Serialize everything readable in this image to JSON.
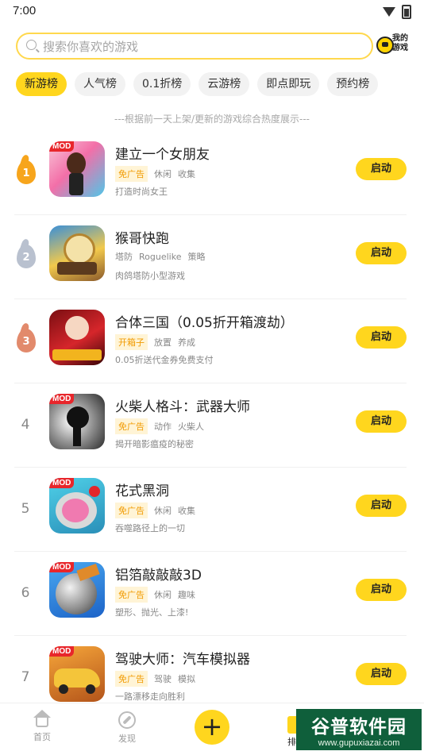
{
  "status": {
    "time": "7:00"
  },
  "search": {
    "placeholder": "搜索你喜欢的游戏",
    "my_games_label": "我的游戏"
  },
  "tabs": [
    {
      "label": "新游榜",
      "active": true
    },
    {
      "label": "人气榜"
    },
    {
      "label": "0.1折榜"
    },
    {
      "label": "云游榜"
    },
    {
      "label": "即点即玩"
    },
    {
      "label": "预约榜"
    }
  ],
  "hint": "---根据前一天上架/更新的游戏综合热度展示---",
  "games": [
    {
      "rank": "1",
      "name": "建立一个女朋友",
      "mod": "MOD",
      "highlight": "免广告",
      "tags": [
        "休闲",
        "收集"
      ],
      "desc": "打造时尚女王",
      "button": "启动"
    },
    {
      "rank": "2",
      "name": "猴哥快跑",
      "mod": "",
      "highlight": "",
      "tags": [
        "塔防",
        "Roguelike",
        "策略"
      ],
      "desc": "肉鸽塔防小型游戏",
      "button": "启动"
    },
    {
      "rank": "3",
      "name": "合体三国（0.05折开箱渡劫）",
      "mod": "",
      "highlight": "开箱子",
      "tags": [
        "放置",
        "养成"
      ],
      "desc": "0.05折送代金券免费支付",
      "button": "启动"
    },
    {
      "rank": "4",
      "name": "火柴人格斗：武器大师",
      "mod": "MOD",
      "highlight": "免广告",
      "tags": [
        "动作",
        "火柴人"
      ],
      "desc": "揭开暗影瘟疫的秘密",
      "button": "启动"
    },
    {
      "rank": "5",
      "name": "花式黑洞",
      "mod": "MOD",
      "highlight": "免广告",
      "tags": [
        "休闲",
        "收集"
      ],
      "desc": "吞噬路径上的一切",
      "button": "启动"
    },
    {
      "rank": "6",
      "name": "铝箔敲敲敲3D",
      "mod": "MOD",
      "highlight": "免广告",
      "tags": [
        "休闲",
        "趣味"
      ],
      "desc": "塑形、抛光、上漆!",
      "button": "启动"
    },
    {
      "rank": "7",
      "name": "驾驶大师：汽车模拟器",
      "mod": "MOD",
      "highlight": "免广告",
      "tags": [
        "驾驶",
        "模拟"
      ],
      "desc": "一路漂移走向胜利",
      "button": "启动"
    }
  ],
  "nav": {
    "home": "首页",
    "discover": "发现",
    "rank": "排行"
  },
  "watermark": {
    "title": "谷普软件园",
    "url": "www.gupuxiazai.com"
  },
  "colors": {
    "accent": "#ffd61e",
    "highlight_text": "#f19a00",
    "mod_badge": "#e8262b"
  }
}
